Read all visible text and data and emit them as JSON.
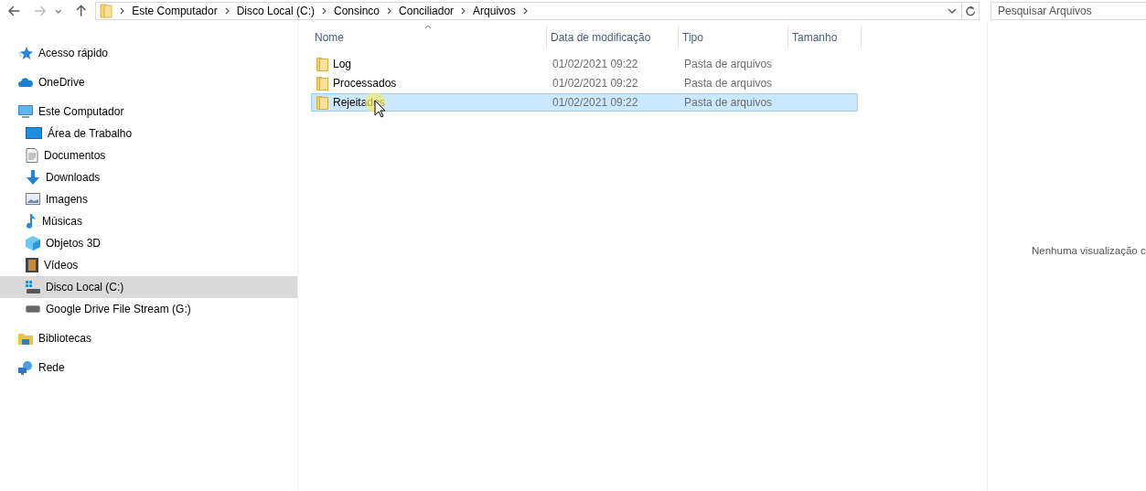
{
  "address_bar": {
    "breadcrumbs": [
      "Este Computador",
      "Disco Local (C:)",
      "Consinco",
      "Conciliador",
      "Arquivos"
    ]
  },
  "search": {
    "placeholder": "Pesquisar Arquivos"
  },
  "sidebar": {
    "items": [
      {
        "label": "Acesso rápido",
        "kind": "star",
        "selected": false
      },
      {
        "label": "OneDrive",
        "kind": "cloud",
        "selected": false
      },
      {
        "label": "Este Computador",
        "kind": "pc",
        "selected": false,
        "children": [
          {
            "label": "Área de Trabalho",
            "kind": "desktop",
            "selected": false
          },
          {
            "label": "Documentos",
            "kind": "doc",
            "selected": false
          },
          {
            "label": "Downloads",
            "kind": "download",
            "selected": false
          },
          {
            "label": "Imagens",
            "kind": "image",
            "selected": false
          },
          {
            "label": "Músicas",
            "kind": "music",
            "selected": false
          },
          {
            "label": "Objetos 3D",
            "kind": "cube",
            "selected": false
          },
          {
            "label": "Vídeos",
            "kind": "video",
            "selected": false
          },
          {
            "label": "Disco Local (C:)",
            "kind": "windrive",
            "selected": true
          },
          {
            "label": "Google Drive File Stream (G:)",
            "kind": "drive",
            "selected": false
          }
        ]
      },
      {
        "label": "Bibliotecas",
        "kind": "library",
        "selected": false
      },
      {
        "label": "Rede",
        "kind": "network",
        "selected": false
      }
    ]
  },
  "table": {
    "columns": [
      "Nome",
      "Data de modificação",
      "Tipo",
      "Tamanho"
    ],
    "rows": [
      {
        "name": "Log",
        "modified": "01/02/2021 09:22",
        "type": "Pasta de arquivos",
        "selected": false
      },
      {
        "name": "Processados",
        "modified": "01/02/2021 09:22",
        "type": "Pasta de arquivos",
        "selected": false
      },
      {
        "name": "Rejeitados",
        "modified": "01/02/2021 09:22",
        "type": "Pasta de arquivos",
        "selected": true
      }
    ]
  },
  "preview": {
    "message": "Nenhuma visualização c"
  }
}
